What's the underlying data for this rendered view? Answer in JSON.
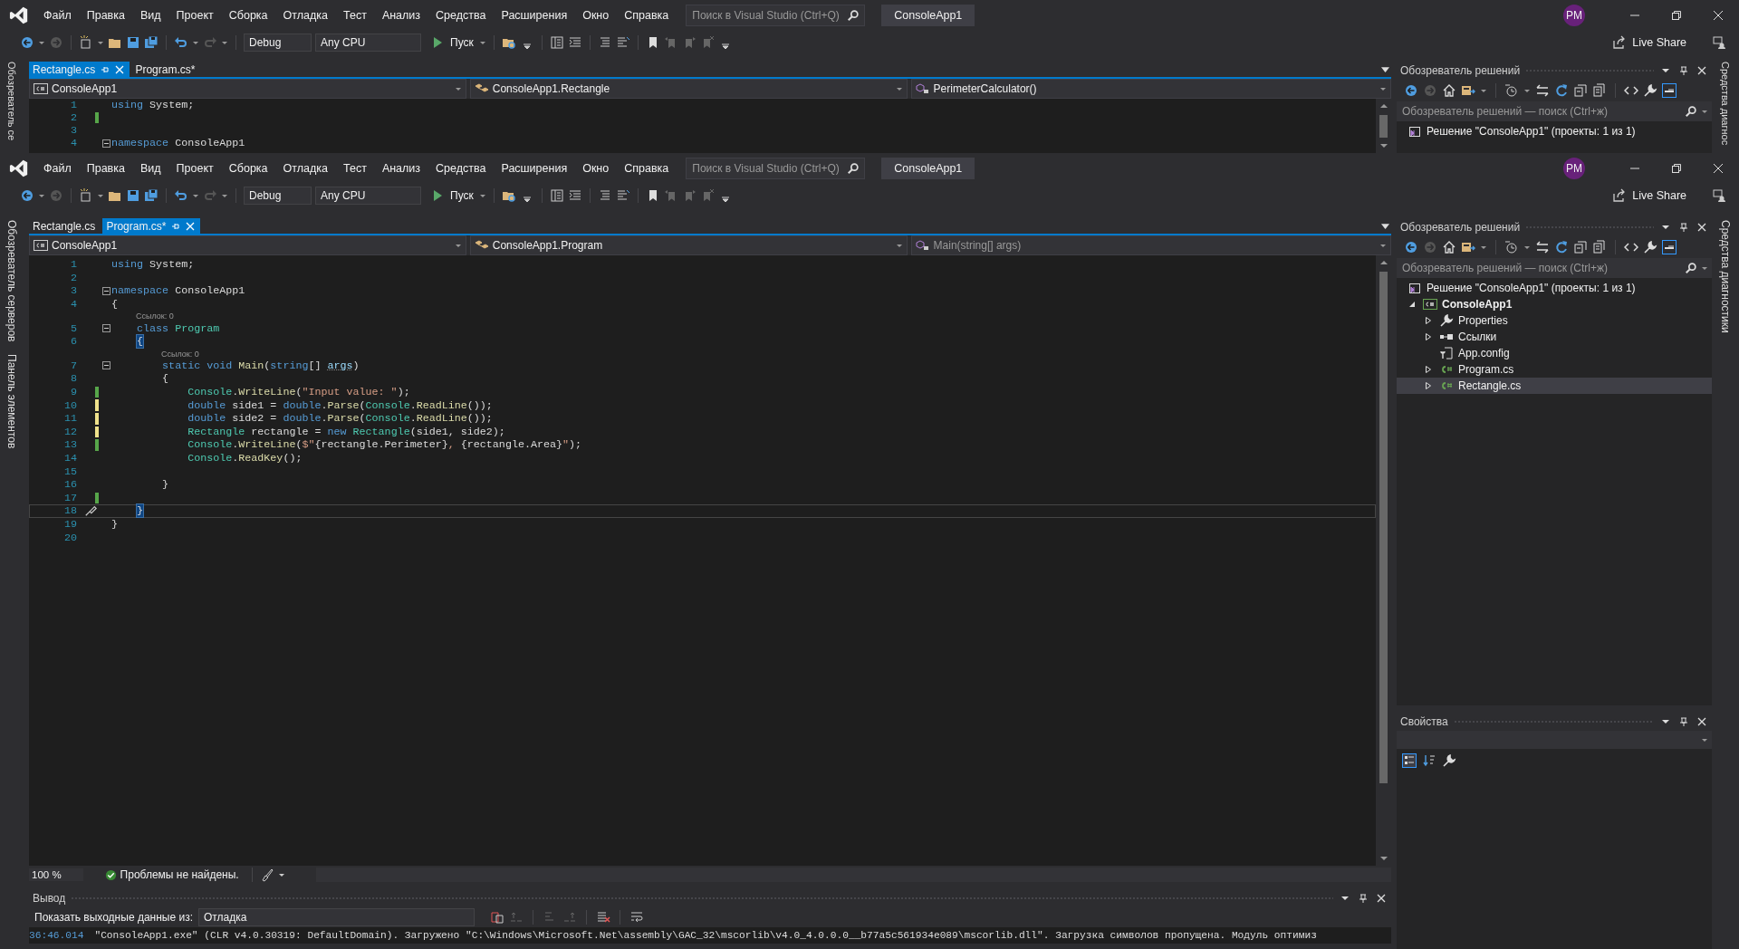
{
  "windows": [
    {
      "title": "ConsoleApp1",
      "menu": [
        "Файл",
        "Правка",
        "Вид",
        "Проект",
        "Сборка",
        "Отладка",
        "Тест",
        "Анализ",
        "Средства",
        "Расширения",
        "Окно",
        "Справка"
      ],
      "search": {
        "placeholder": "Поиск в Visual Studio (Ctrl+Q)"
      },
      "avatar": "PM",
      "live_share": "Live Share",
      "toolbar": {
        "configuration": "Debug",
        "platform": "Any CPU",
        "run": "Пуск"
      },
      "left_strip": [
        "Обозреватель се"
      ],
      "right_strip": [
        "Средства диагнос"
      ],
      "tabs": [
        {
          "label": "Rectangle.cs",
          "selected": true
        },
        {
          "label": "Program.cs*",
          "selected": false
        }
      ],
      "nav": [
        {
          "kind": "project",
          "label": "ConsoleApp1",
          "disabled": false
        },
        {
          "kind": "class",
          "label": "ConsoleApp1.Rectangle",
          "disabled": false
        },
        {
          "kind": "member",
          "label": "PerimeterCalculator()",
          "disabled": false
        }
      ],
      "code": [
        {
          "kind": "line",
          "num": "1",
          "fold": false,
          "current": false,
          "segs": [
            {
              "kind": "kw",
              "text": "using"
            },
            {
              "kind": "plain",
              "text": " System;"
            }
          ]
        },
        {
          "kind": "line",
          "num": "2",
          "fold": false,
          "current": false,
          "modified": true,
          "saved": true
        },
        {
          "kind": "line",
          "num": "3",
          "fold": false,
          "current": false
        },
        {
          "kind": "line",
          "num": "4",
          "fold": true,
          "current": false,
          "segs": [
            {
              "kind": "kw",
              "text": "namespace"
            },
            {
              "kind": "plain",
              "text": " ConsoleApp1"
            }
          ]
        }
      ],
      "solution_explorer": {
        "title": "Обозреватель решений",
        "search": {
          "placeholder": "Обозреватель решений — поиск (Ctrl+ж)"
        },
        "tree": [
          {
            "kind": "solution",
            "label": "Решение \"ConsoleApp1\" (проекты: 1 из 1)",
            "bold": false,
            "selected": false
          }
        ]
      }
    },
    {
      "title": "ConsoleApp1",
      "menu": [
        "Файл",
        "Правка",
        "Вид",
        "Проект",
        "Сборка",
        "Отладка",
        "Тест",
        "Анализ",
        "Средства",
        "Расширения",
        "Окно",
        "Справка"
      ],
      "search": {
        "placeholder": "Поиск в Visual Studio (Ctrl+Q)"
      },
      "avatar": "PM",
      "live_share": "Live Share",
      "toolbar": {
        "configuration": "Debug",
        "platform": "Any CPU",
        "run": "Пуск"
      },
      "left_strip": [
        "Обозреватель серверов",
        "Панель элементов"
      ],
      "right_strip": [
        "Средства диагностики"
      ],
      "tabs": [
        {
          "label": "Rectangle.cs",
          "selected": false
        },
        {
          "label": "Program.cs*",
          "selected": true
        }
      ],
      "nav": [
        {
          "kind": "project",
          "label": "ConsoleApp1",
          "disabled": false
        },
        {
          "kind": "class",
          "label": "ConsoleApp1.Program",
          "disabled": false
        },
        {
          "kind": "member",
          "label": "Main(string[] args)",
          "disabled": true
        }
      ],
      "code": [
        {
          "kind": "line",
          "num": "1",
          "fold": false,
          "current": false,
          "segs": [
            {
              "kind": "kw",
              "text": "using"
            },
            {
              "kind": "plain",
              "text": " System;"
            }
          ]
        },
        {
          "kind": "line",
          "num": "2",
          "fold": false,
          "current": false
        },
        {
          "kind": "line",
          "num": "3",
          "fold": true,
          "current": false,
          "segs": [
            {
              "kind": "kw",
              "text": "namespace"
            },
            {
              "kind": "plain",
              "text": " ConsoleApp1"
            }
          ]
        },
        {
          "kind": "line",
          "num": "4",
          "fold": false,
          "current": false,
          "segs": [
            {
              "kind": "plain",
              "text": "{"
            }
          ]
        },
        {
          "kind": "lens",
          "text": "Ссылок: 0"
        },
        {
          "kind": "line",
          "num": "5",
          "fold": true,
          "current": false,
          "segs": [
            {
              "kind": "kw",
              "text": "    class "
            },
            {
              "kind": "type",
              "text": "Program"
            }
          ]
        },
        {
          "kind": "line",
          "num": "6",
          "fold": false,
          "current": false,
          "segs": [
            {
              "kind": "brace",
              "text": "    {"
            }
          ]
        },
        {
          "kind": "lens",
          "text": "Ссылок: 0"
        },
        {
          "kind": "line",
          "num": "7",
          "fold": true,
          "current": false,
          "segs": [
            {
              "kind": "kw",
              "text": "        static void "
            },
            {
              "kind": "method",
              "text": "Main"
            },
            {
              "kind": "plain",
              "text": "("
            },
            {
              "kind": "kw",
              "text": "string"
            },
            {
              "kind": "plain",
              "text": "[] "
            },
            {
              "kind": "unused",
              "text": "args"
            },
            {
              "kind": "plain",
              "text": ")"
            }
          ]
        },
        {
          "kind": "line",
          "num": "8",
          "fold": false,
          "current": false,
          "segs": [
            {
              "kind": "plain",
              "text": "        {"
            }
          ]
        },
        {
          "kind": "line",
          "num": "9",
          "fold": false,
          "current": false,
          "modified": true,
          "saved": true,
          "segs": [
            {
              "kind": "type",
              "text": "            Console"
            },
            {
              "kind": "plain",
              "text": "."
            },
            {
              "kind": "method",
              "text": "WriteLine"
            },
            {
              "kind": "plain",
              "text": "("
            },
            {
              "kind": "str",
              "text": "\"Input value: \""
            },
            {
              "kind": "plain",
              "text": ");"
            }
          ]
        },
        {
          "kind": "line",
          "num": "10",
          "fold": false,
          "current": false,
          "modified": true,
          "saved": false,
          "segs": [
            {
              "kind": "kw",
              "text": "            double"
            },
            {
              "kind": "plain",
              "text": " side1 = "
            },
            {
              "kind": "kw",
              "text": "double"
            },
            {
              "kind": "plain",
              "text": "."
            },
            {
              "kind": "method",
              "text": "Parse"
            },
            {
              "kind": "plain",
              "text": "("
            },
            {
              "kind": "type",
              "text": "Console"
            },
            {
              "kind": "plain",
              "text": "."
            },
            {
              "kind": "method",
              "text": "ReadLine"
            },
            {
              "kind": "plain",
              "text": "());"
            }
          ]
        },
        {
          "kind": "line",
          "num": "11",
          "fold": false,
          "current": false,
          "modified": true,
          "saved": false,
          "segs": [
            {
              "kind": "kw",
              "text": "            double"
            },
            {
              "kind": "plain",
              "text": " side2 = "
            },
            {
              "kind": "kw",
              "text": "double"
            },
            {
              "kind": "plain",
              "text": "."
            },
            {
              "kind": "method",
              "text": "Parse"
            },
            {
              "kind": "plain",
              "text": "("
            },
            {
              "kind": "type",
              "text": "Console"
            },
            {
              "kind": "plain",
              "text": "."
            },
            {
              "kind": "method",
              "text": "ReadLine"
            },
            {
              "kind": "plain",
              "text": "());"
            }
          ]
        },
        {
          "kind": "line",
          "num": "12",
          "fold": false,
          "current": false,
          "modified": true,
          "saved": false,
          "segs": [
            {
              "kind": "type",
              "text": "            Rectangle"
            },
            {
              "kind": "plain",
              "text": " rectangle = "
            },
            {
              "kind": "kw",
              "text": "new "
            },
            {
              "kind": "type",
              "text": "Rectangle"
            },
            {
              "kind": "plain",
              "text": "(side1, side2);"
            }
          ]
        },
        {
          "kind": "line",
          "num": "13",
          "fold": false,
          "current": false,
          "modified": true,
          "saved": true,
          "segs": [
            {
              "kind": "type",
              "text": "            Console"
            },
            {
              "kind": "plain",
              "text": "."
            },
            {
              "kind": "method",
              "text": "WriteLine"
            },
            {
              "kind": "plain",
              "text": "("
            },
            {
              "kind": "str",
              "text": "$\""
            },
            {
              "kind": "plain",
              "text": "{rectangle.Perimeter}"
            },
            {
              "kind": "str",
              "text": ", "
            },
            {
              "kind": "plain",
              "text": "{rectangle.Area}"
            },
            {
              "kind": "str",
              "text": "\""
            },
            {
              "kind": "plain",
              "text": ");"
            }
          ]
        },
        {
          "kind": "line",
          "num": "14",
          "fold": false,
          "current": false,
          "segs": [
            {
              "kind": "type",
              "text": "            Console"
            },
            {
              "kind": "plain",
              "text": "."
            },
            {
              "kind": "method",
              "text": "ReadKey"
            },
            {
              "kind": "plain",
              "text": "();"
            }
          ]
        },
        {
          "kind": "line",
          "num": "15",
          "fold": false,
          "current": false
        },
        {
          "kind": "line",
          "num": "16",
          "fold": false,
          "current": false,
          "segs": [
            {
              "kind": "plain",
              "text": "        }"
            }
          ]
        },
        {
          "kind": "line",
          "num": "17",
          "fold": false,
          "current": false,
          "modified": true,
          "saved": true
        },
        {
          "kind": "line",
          "num": "18",
          "fold": false,
          "current": true,
          "segs": [
            {
              "kind": "brace",
              "text": "    }"
            }
          ]
        },
        {
          "kind": "line",
          "num": "19",
          "fold": false,
          "current": false,
          "segs": [
            {
              "kind": "plain",
              "text": "}"
            }
          ]
        },
        {
          "kind": "line",
          "num": "20",
          "fold": false,
          "current": false
        }
      ],
      "status": {
        "zoom": "100 %",
        "issues": "Проблемы не найдены."
      },
      "output": {
        "title": "Вывод",
        "source_label": "Показать выходные данные из:",
        "source": "Отладка",
        "lines": [
          {
            "time": "36:46.014",
            "text": "\"ConsoleApp1.exe\" (CLR v4.0.30319: DefaultDomain). Загружено \"C:\\Windows\\Microsoft.Net\\assembly\\GAC_32\\mscorlib\\v4.0_4.0.0.0__b77a5c561934e089\\mscorlib.dll\". Загрузка символов пропущена. Модуль оптимиз"
          }
        ]
      },
      "solution_explorer": {
        "title": "Обозреватель решений",
        "search": {
          "placeholder": "Обозреватель решений — поиск (Ctrl+ж)"
        },
        "tree": [
          {
            "kind": "solution",
            "label": "Решение \"ConsoleApp1\" (проекты: 1 из 1)",
            "bold": false,
            "selected": false
          },
          {
            "kind": "project",
            "label": "ConsoleApp1",
            "bold": true,
            "expandable": true,
            "expanded": true,
            "selected": false,
            "children": [
              {
                "kind": "properties",
                "label": "Properties",
                "bold": false,
                "expandable": true,
                "expanded": false,
                "selected": false
              },
              {
                "kind": "references",
                "label": "Ссылки",
                "bold": false,
                "expandable": true,
                "expanded": false,
                "selected": false
              },
              {
                "kind": "config",
                "label": "App.config",
                "bold": false,
                "expandable": false,
                "selected": false
              },
              {
                "kind": "csfile",
                "label": "Program.cs",
                "bold": false,
                "expandable": true,
                "expanded": false,
                "selected": false
              },
              {
                "kind": "csfile",
                "label": "Rectangle.cs",
                "bold": false,
                "expandable": true,
                "expanded": false,
                "selected": true
              }
            ]
          }
        ]
      },
      "properties": {
        "title": "Свойства"
      }
    }
  ]
}
